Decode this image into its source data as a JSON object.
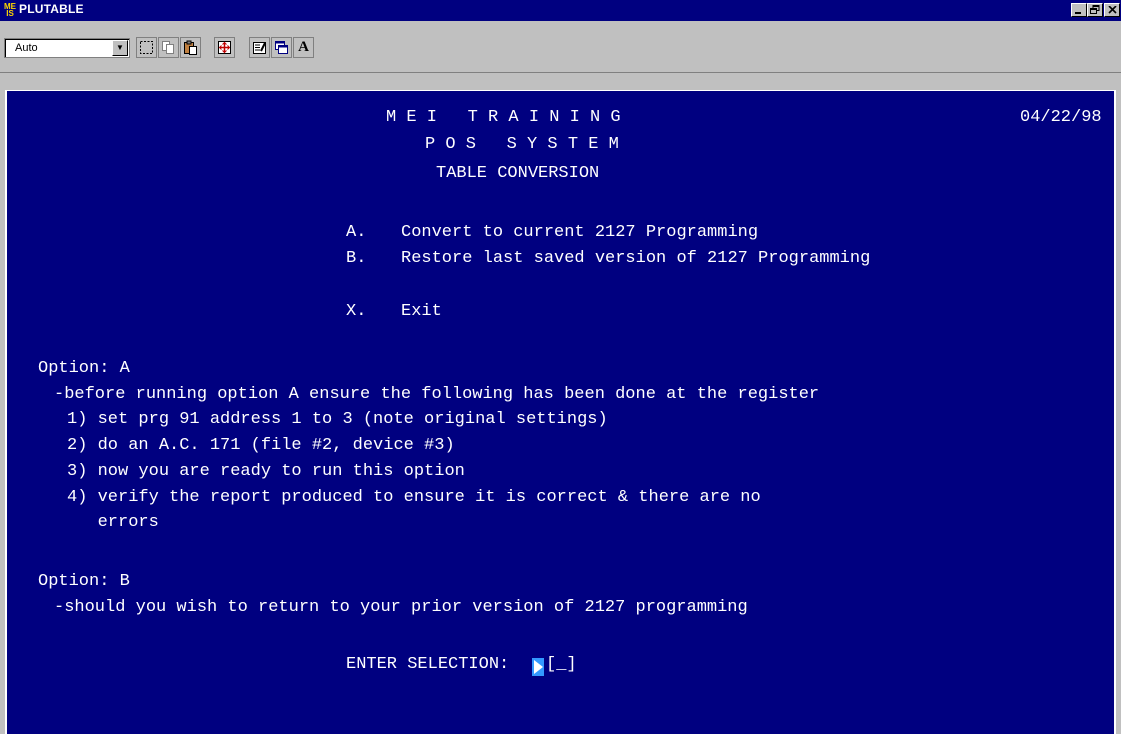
{
  "window": {
    "icon_text_top": "ME",
    "icon_text_bottom": "IS",
    "title": "PLUTABLE",
    "minimize_label": "_",
    "maximize_label": "ê",
    "close_label": "×"
  },
  "toolbar": {
    "font_size_value": "Auto",
    "dropdown_arrow": "▼",
    "font_button_label": "A"
  },
  "terminal": {
    "header_title": "M E I   T R A I N I N G",
    "header_date": "04/22/98",
    "header_subtitle": "P O S   S Y S T E M",
    "header_section": "TABLE CONVERSION",
    "menu": [
      {
        "key": "A.",
        "text": "Convert to current 2127 Programming"
      },
      {
        "key": "B.",
        "text": "Restore last saved version of 2127 Programming"
      },
      {
        "key": "X.",
        "text": "Exit"
      }
    ],
    "option_a_heading": "Option: A",
    "option_a_intro": "-before running option A ensure the following has been done at the register",
    "option_a_steps": [
      "1) set prg 91 address 1 to 3 (note original settings)",
      "2) do an A.C. 171 (file #2, device #3)",
      "3) now you are ready to run this option",
      "4) verify the report produced to ensure it is correct & there are no",
      "   errors"
    ],
    "option_b_heading": "Option: B",
    "option_b_text": "-should you wish to return to your prior version of 2127 programming",
    "prompt_label": "ENTER SELECTION:",
    "prompt_field": "[_]"
  }
}
